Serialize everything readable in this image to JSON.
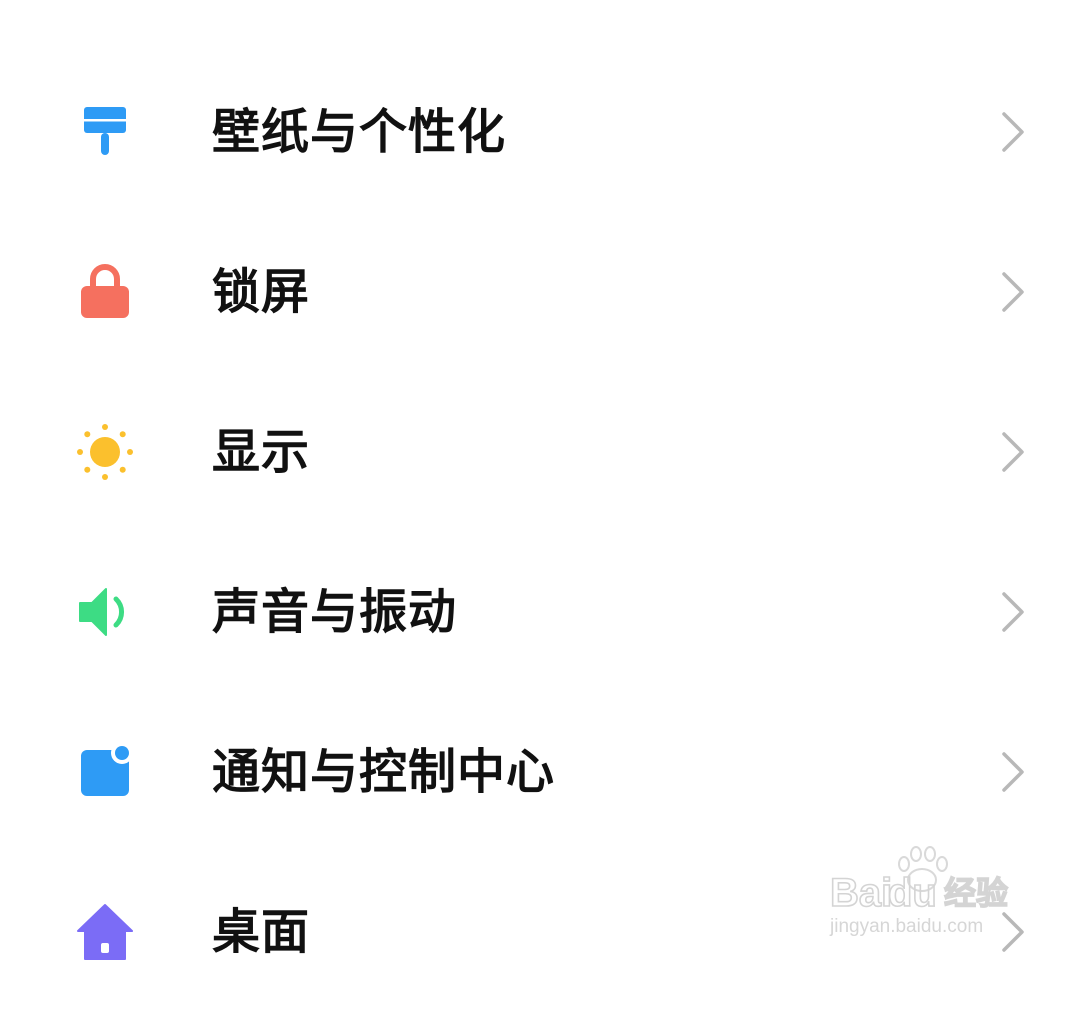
{
  "settings": {
    "items": [
      {
        "label": "壁纸与个性化",
        "icon": "paintbrush-icon",
        "color": "#2E9BF5"
      },
      {
        "label": "锁屏",
        "icon": "lock-icon",
        "color": "#F5705F"
      },
      {
        "label": "显示",
        "icon": "sun-icon",
        "color": "#FBC02D"
      },
      {
        "label": "声音与振动",
        "icon": "speaker-icon",
        "color": "#3DDC84"
      },
      {
        "label": "通知与控制中心",
        "icon": "notification-icon",
        "color": "#2E9BF5"
      },
      {
        "label": "桌面",
        "icon": "home-icon",
        "color": "#7B6CF6"
      }
    ],
    "chevron_color": "#B8B8B8"
  },
  "watermark": {
    "brand": "Baidu经验",
    "url": "jingyan.baidu.com"
  }
}
